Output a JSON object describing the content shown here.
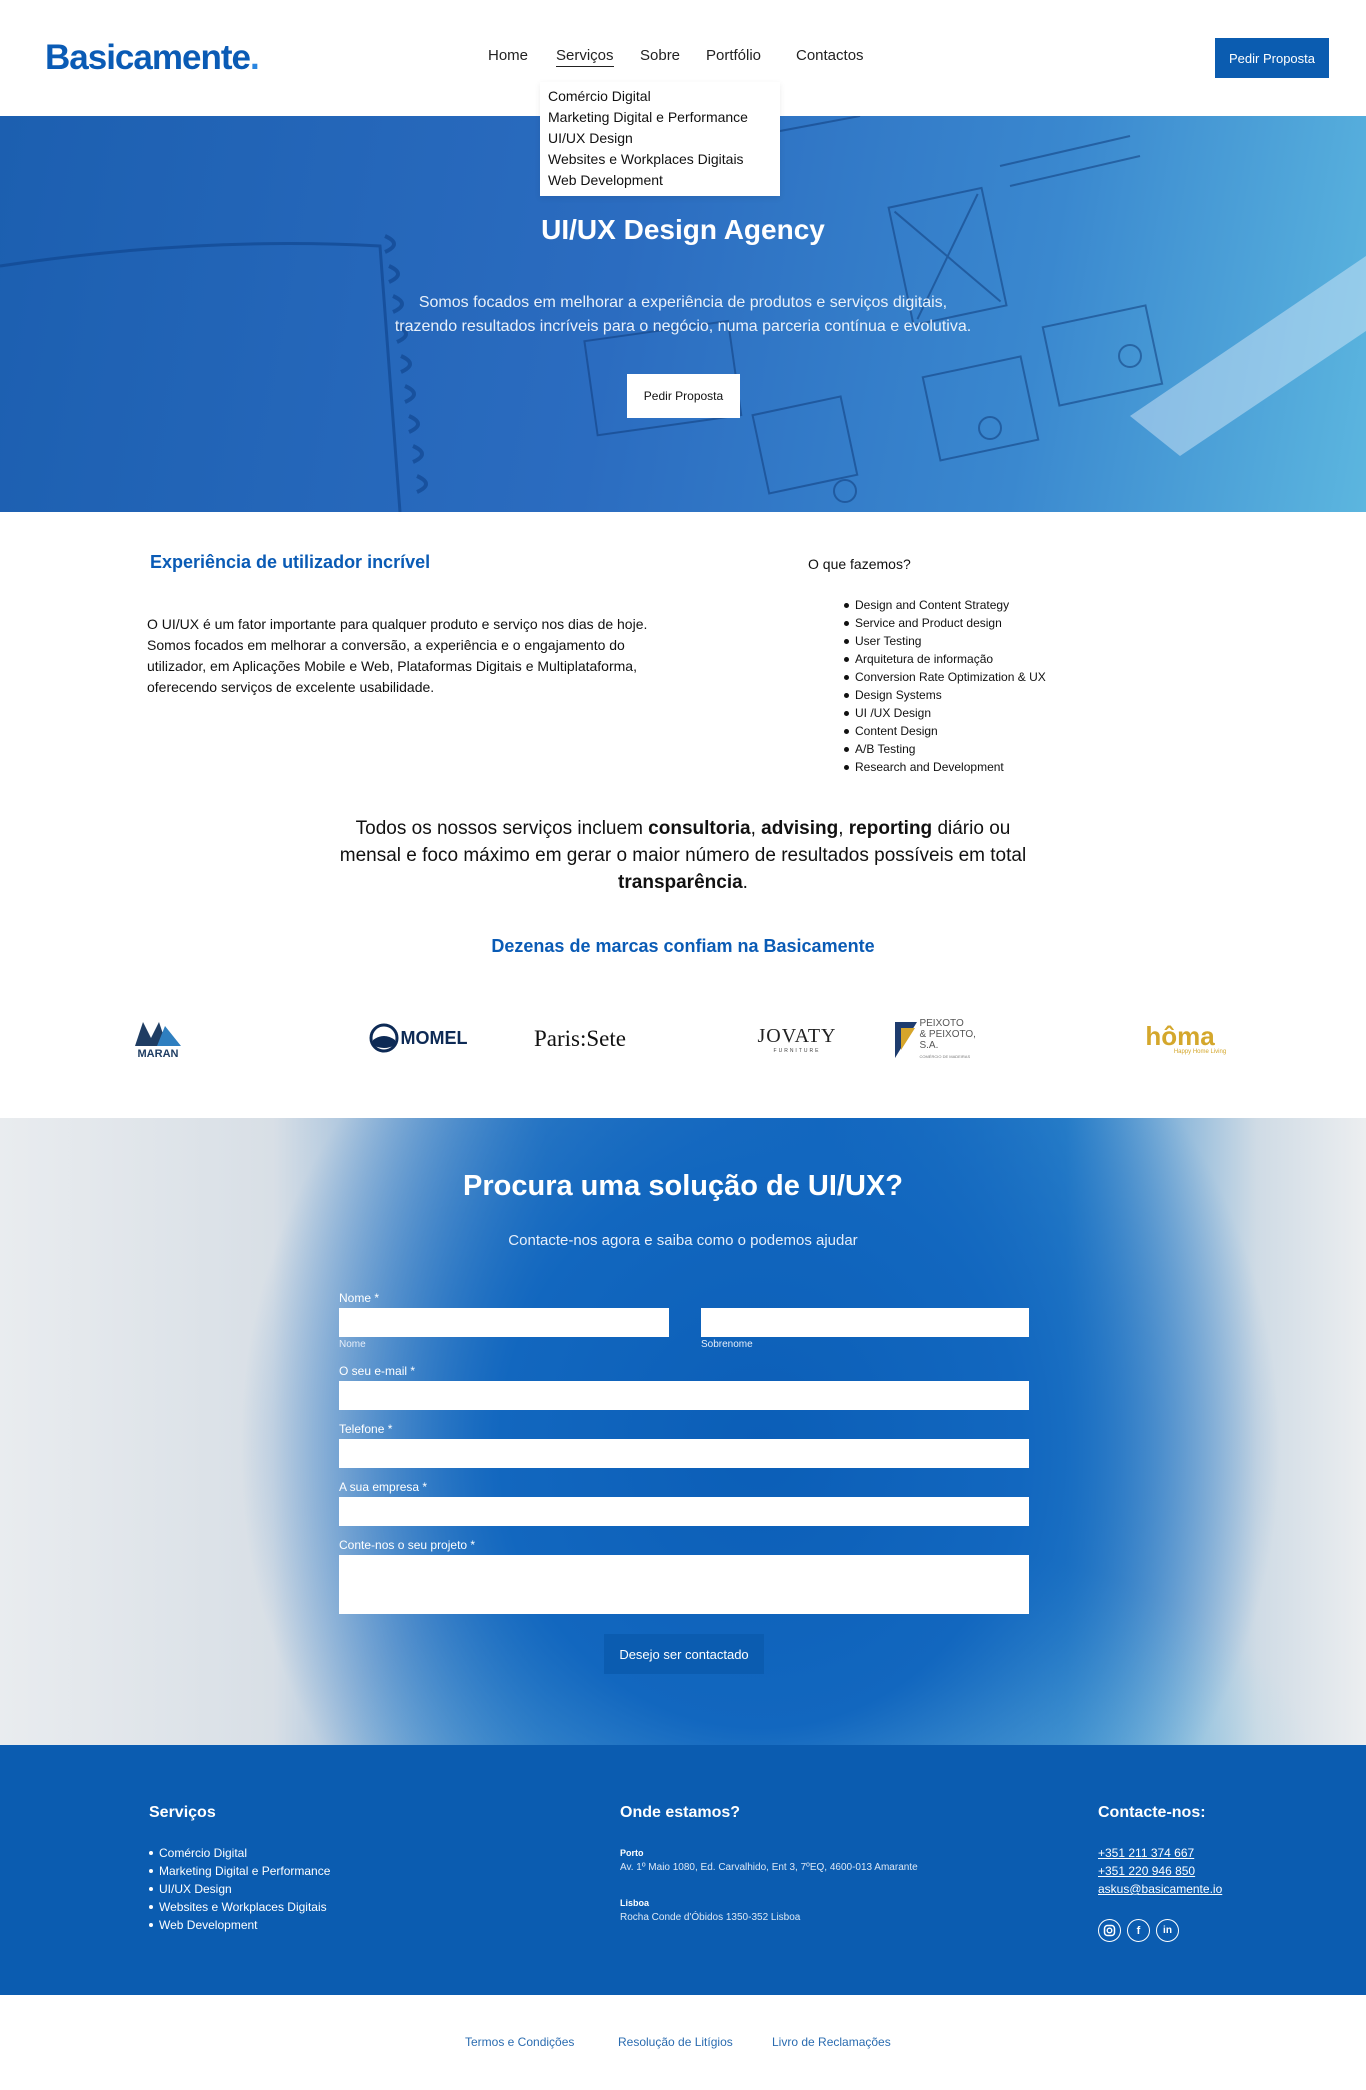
{
  "header": {
    "logo": "Basicamente",
    "logo_dot": ".",
    "nav": [
      "Home",
      "Serviços",
      "Sobre",
      "Portfólio",
      "Contactos"
    ],
    "cta": "Pedir Proposta"
  },
  "dropdown": {
    "items": [
      "Comércio Digital",
      "Marketing Digital e Performance",
      "UI/UX Design",
      "Websites e Workplaces Digitais",
      "Web Development"
    ]
  },
  "hero": {
    "title": "UI/UX Design Agency",
    "subtitle_line1": "Somos focados em melhorar a experiência de produtos e serviços digitais,",
    "subtitle_line2": "trazendo resultados incríveis para o negócio, numa parceria contínua e evolutiva.",
    "cta": "Pedir Proposta"
  },
  "intro": {
    "title": "Experiência de utilizador incrível",
    "text": "O UI/UX é um fator importante para qualquer produto e serviço nos dias de hoje. Somos focados em melhorar a conversão, a experiência e o engajamento do utilizador, em Aplicações Mobile e Web, Plataformas Digitais e Multiplataforma, oferecendo serviços de excelente usabilidade.",
    "what_title": "O que fazemos?",
    "what_items": [
      "Design and Content Strategy",
      "Service and Product design",
      "User Testing",
      "Arquitetura de informação",
      "Conversion Rate Optimization & UX",
      "Design Systems",
      "UI /UX Design",
      "Content Design",
      "A/B Testing",
      "Research and Development"
    ]
  },
  "statement": {
    "t1": "Todos os nossos serviços incluem ",
    "b1": "consultoria",
    "t2": ", ",
    "b2": "advising",
    "t3": ", ",
    "b3": "reporting",
    "t4": " diário ou mensal e foco máximo em gerar o maior número de resultados possíveis em total ",
    "b4": "transparência",
    "t5": "."
  },
  "brands": {
    "title": "Dezenas de marcas confiam na Basicamente",
    "maran": "MARAN",
    "momel": "MOMEL",
    "parissete": "Paris:Sete",
    "jovaty": "JOVATY",
    "jovaty_sub": "FURNITURE",
    "peixoto_1": "PEIXOTO",
    "peixoto_2": "& PEIXOTO, S.A.",
    "peixoto_3": "COMÉRCIO DE MADEIRAS",
    "homa": "hôma",
    "homa_sub": "Happy Home Living"
  },
  "contact": {
    "title": "Procura uma solução de UI/UX?",
    "subtitle": "Contacte-nos agora e saiba como o podemos ajudar",
    "name_label": "Nome *",
    "first_name_hint": "Nome",
    "last_name_hint": "Sobrenome",
    "email_label": "O seu e-mail *",
    "phone_label": "Telefone *",
    "company_label": "A sua empresa *",
    "project_label": "Conte-nos o seu projeto *",
    "submit": "Desejo ser contactado"
  },
  "footer": {
    "services_title": "Serviços",
    "services": [
      "Comércio Digital",
      "Marketing Digital e Performance",
      "UI/UX Design",
      "Websites e Workplaces Digitais",
      "Web Development"
    ],
    "where_title": "Onde estamos?",
    "porto_label": "Porto",
    "porto_address": "Av. 1º Maio 1080, Ed. Carvalhido, Ent 3, 7ºEQ, 4600-013 Amarante",
    "lisboa_label": "Lisboa",
    "lisboa_address": "Rocha Conde d'Óbidos 1350-352 Lisboa",
    "contact_title": "Contacte-nos:",
    "phone1": "+351 211 374 667",
    "phone2": "+351 220 946 850",
    "email": "askus@basicamente.io",
    "social": [
      "instagram-icon",
      "facebook-icon",
      "linkedin-icon"
    ]
  },
  "legal": {
    "terms": "Termos e Condições",
    "disputes": "Resolução de Litígios",
    "complaints": "Livro de Reclamações"
  },
  "colors": {
    "brand_blue": "#0b5cb0",
    "title_blue": "#0a5bb5"
  }
}
